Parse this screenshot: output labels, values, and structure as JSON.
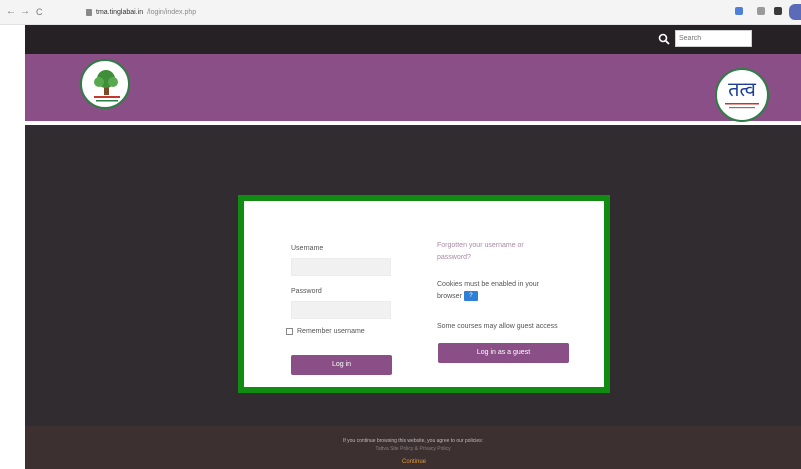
{
  "browser": {
    "back": "←",
    "forward": "→",
    "reload": "C",
    "url_host": "tma.tinglabai.in",
    "url_path": "/login/index.php",
    "ext_colors": [
      "#4f7fd8",
      "#9a9a9a",
      "#3a3a3a"
    ],
    "profile_color": "#5b6bb8"
  },
  "topbar": {
    "search_placeholder": "Search"
  },
  "banner": {
    "right_logo_text": "तत्व",
    "accent": "#8a4f86"
  },
  "login": {
    "username_label": "Username",
    "username_value": "",
    "password_label": "Password",
    "password_value": "",
    "remember_label": "Remember username",
    "login_button": "Log in",
    "forgot_link": "Forgotten your username or password?",
    "cookies_text": "Cookies must be enabled in your browser",
    "cookies_help_icon": "?",
    "guest_text": "Some courses may allow guest access",
    "guest_button": "Log in as a guest",
    "border_color": "#118b11"
  },
  "footer": {
    "notice": "If you continue browsing this website, you agree to our policies:",
    "policy_link": "Tattva Site Policy & Privacy Policy",
    "continue": "Continue"
  }
}
